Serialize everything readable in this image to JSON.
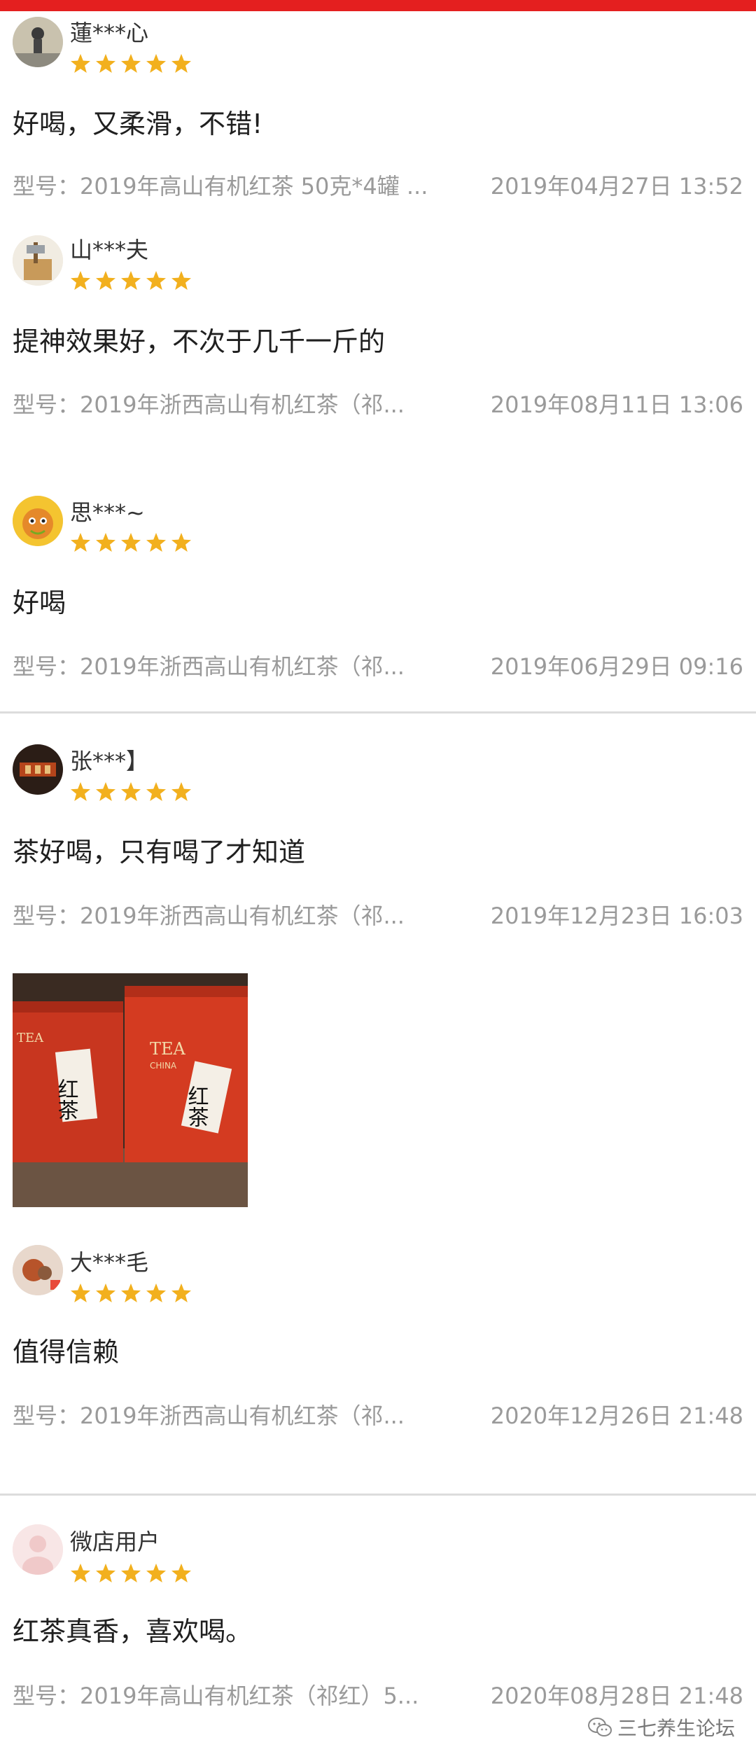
{
  "reviews": [
    {
      "user": "蓮***心",
      "stars": 5,
      "comment": "好喝，又柔滑，不错!",
      "model": "型号：2019年高山有机红茶 50克*4罐 ...",
      "date": "2019年04月27日 13:52"
    },
    {
      "user": "山***夫",
      "stars": 5,
      "comment": "提神效果好，不次于几千一斤的",
      "model": "型号：2019年浙西高山有机红茶（祁...",
      "date": "2019年08月11日 13:06"
    },
    {
      "user": "思***~",
      "stars": 5,
      "comment": "好喝",
      "model": "型号：2019年浙西高山有机红茶（祁...",
      "date": "2019年06月29日 09:16"
    },
    {
      "user": "张***】",
      "stars": 5,
      "comment": "茶好喝，只有喝了才知道",
      "model": "型号：2019年浙西高山有机红茶（祁...",
      "date": "2019年12月23日 16:03"
    },
    {
      "user": "大***毛",
      "stars": 5,
      "comment": "值得信赖",
      "model": "型号：2019年浙西高山有机红茶（祁...",
      "date": "2020年12月26日 21:48"
    },
    {
      "user": "微店用户",
      "stars": 5,
      "comment": "红茶真香，喜欢喝。",
      "model": "型号：2019年高山有机红茶（祁红）5...",
      "date": "2020年08月28日 21:48"
    }
  ],
  "photo": {
    "label_left": "红茶",
    "label_right": "红茶",
    "brand": "TEA",
    "brand_sub": "CHINA"
  },
  "watermark": {
    "text": "三七养生论坛",
    "icon": "wechat-icon"
  },
  "colors": {
    "topbar": "#e41f1f",
    "star": "#f2b01e"
  }
}
